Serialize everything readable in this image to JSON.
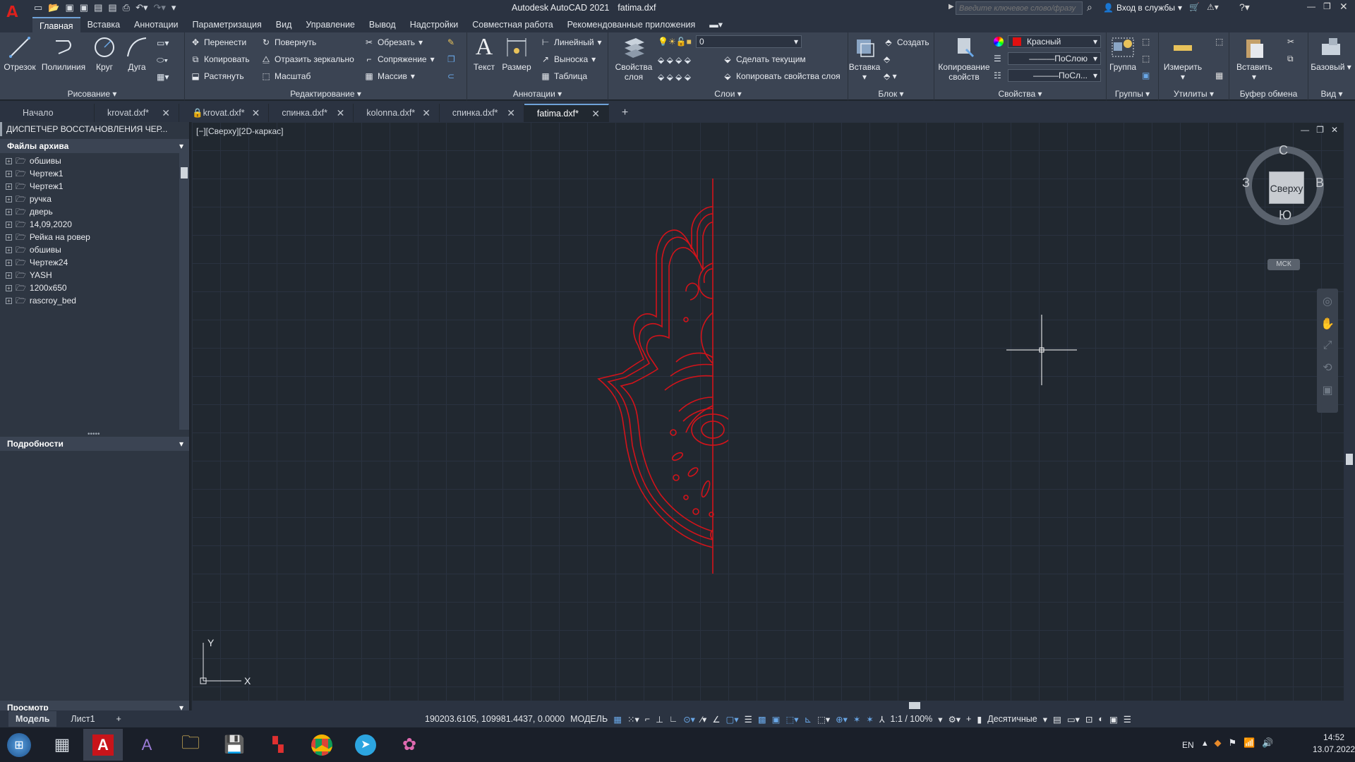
{
  "titlebar": {
    "app_title": "Autodesk AutoCAD 2021",
    "file_title": "fatima.dxf",
    "search_placeholder": "Введите ключевое слово/фразу",
    "signin_label": "Вход в службы"
  },
  "menu_tabs": [
    "Главная",
    "Вставка",
    "Аннотации",
    "Параметризация",
    "Вид",
    "Управление",
    "Вывод",
    "Надстройки",
    "Совместная работа",
    "Рекомендованные приложения"
  ],
  "ribbon": {
    "draw": {
      "label": "Рисование",
      "line": "Отрезок",
      "polyline": "Полилиния",
      "circle": "Круг",
      "arc": "Дуга"
    },
    "modify": {
      "label": "Редактирование",
      "move": "Перенести",
      "rotate": "Повернуть",
      "trim": "Обрезать",
      "copy": "Копировать",
      "mirror": "Отразить зеркально",
      "fillet": "Сопряжение",
      "stretch": "Растянуть",
      "scale": "Масштаб",
      "array": "Массив"
    },
    "annotation": {
      "label": "Аннотации",
      "text": "Текст",
      "dimension": "Размер",
      "linear": "Линейный",
      "leader": "Выноска",
      "table": "Таблица"
    },
    "layers": {
      "label": "Слои",
      "properties": "Свойства слоя",
      "layer_value": "0",
      "make_current": "Сделать текущим",
      "match_layer": "Копировать свойства слоя"
    },
    "block": {
      "label": "Блок",
      "insert": "Вставка",
      "create": "Создать"
    },
    "properties": {
      "label": "Свойства",
      "match": "Копирование свойств",
      "color": "Красный",
      "color_hex": "#e01010",
      "lineweight": "ПоСлою",
      "linetype": "ПоСл..."
    },
    "groups": {
      "label": "Группы",
      "group": "Группа"
    },
    "utilities": {
      "label": "Утилиты",
      "measure": "Измерить"
    },
    "clipboard": {
      "label": "Буфер обмена",
      "paste": "Вставить"
    },
    "view": {
      "label": "Вид",
      "base": "Базовый"
    }
  },
  "doc_tabs": [
    {
      "label": "Начало",
      "active": false,
      "close": false
    },
    {
      "label": "krovat.dxf*",
      "active": false,
      "close": true
    },
    {
      "label": "krovat.dxf*",
      "active": false,
      "close": true,
      "lock": true
    },
    {
      "label": "спинка.dxf*",
      "active": false,
      "close": true
    },
    {
      "label": "kolonna.dxf*",
      "active": false,
      "close": true
    },
    {
      "label": "спинка.dxf*",
      "active": false,
      "close": true
    },
    {
      "label": "fatima.dxf*",
      "active": true,
      "close": true
    }
  ],
  "left_panel": {
    "title": "ДИСПЕТЧЕР ВОССТАНОВЛЕНИЯ ЧЕР...",
    "archive_header": "Файлы архива",
    "archive_items": [
      "обшивы",
      "Чертеж1",
      "Чертеж1",
      "ручка",
      "дверь",
      "14,09,2020",
      "Рейка на ровер",
      "обшивы",
      "Чертеж24",
      "YASH",
      "1200x650",
      "rascroy_bed"
    ],
    "details_header": "Подробности",
    "preview_header": "Просмотр"
  },
  "viewport": {
    "label": "[−][Сверху][2D-каркас]",
    "viewcube_top": "Сверху",
    "compass_n": "С",
    "compass_s": "Ю",
    "compass_w": "З",
    "compass_e": "В",
    "ucs_label": "МСК",
    "axis_x": "X",
    "axis_y": "Y"
  },
  "layout_tabs": [
    "Модель",
    "Лист1"
  ],
  "status": {
    "coords": "190203.6105, 109981.4437, 0.0000",
    "mode": "МОДЕЛЬ",
    "scale": "1:1 / 100%",
    "units": "Десятичные"
  },
  "taskbar": {
    "lang": "EN",
    "time": "14:52",
    "date": "13.07.2022"
  }
}
